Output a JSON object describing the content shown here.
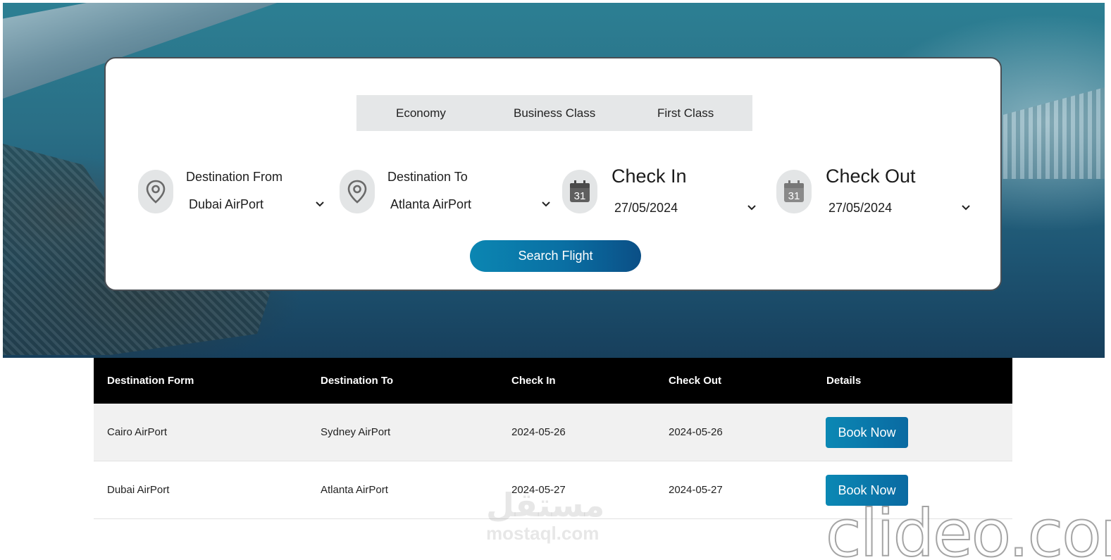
{
  "tabs": [
    {
      "label": "Economy"
    },
    {
      "label": "Business Class"
    },
    {
      "label": "First Class"
    }
  ],
  "search": {
    "from_label": "Destination From",
    "from_value": "Dubai AirPort",
    "to_label": "Destination To",
    "to_value": "Atlanta AirPort",
    "checkin_label": "Check In",
    "checkin_value": "27/05/2024",
    "checkout_label": "Check Out",
    "checkout_value": "27/05/2024",
    "calendar_day": "31",
    "button_label": "Search Flight"
  },
  "table": {
    "headers": [
      "Destination Form",
      "Destination To",
      "Check In",
      "Check Out",
      "Details"
    ],
    "rows": [
      {
        "from": "Cairo AirPort",
        "to": "Sydney AirPort",
        "check_in": "2024-05-26",
        "check_out": "2024-05-26",
        "action": "Book Now"
      },
      {
        "from": "Dubai AirPort",
        "to": "Atlanta AirPort",
        "check_in": "2024-05-27",
        "check_out": "2024-05-27",
        "action": "Book Now"
      }
    ]
  },
  "watermarks": {
    "arabic": "مستقل",
    "mostaql": "mostaql.com",
    "clideo": "clideo.com"
  },
  "colors": {
    "accent": "#0a6fa3",
    "header_bg": "#000000",
    "row_alt": "#f1f1f1"
  }
}
